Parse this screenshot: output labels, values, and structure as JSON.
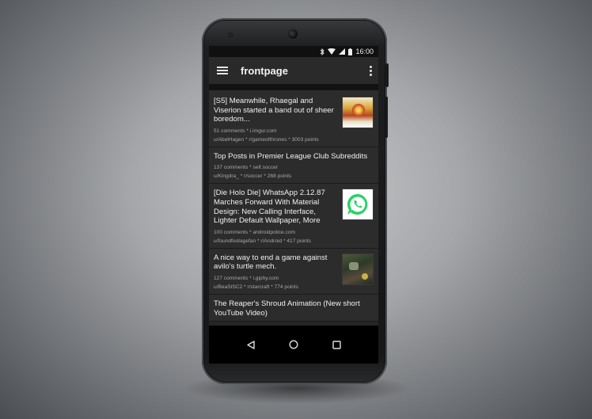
{
  "status_bar": {
    "time": "16:00",
    "icons": [
      "bluetooth-icon",
      "wifi-icon",
      "signal-icon",
      "battery-icon"
    ]
  },
  "app_bar": {
    "title": "frontpage",
    "menu_icon": "hamburger-menu-icon",
    "overflow_icon": "more-vert-icon"
  },
  "posts": [
    {
      "title": "[S5] Meanwhile, Rhaegal and Viserion started a band out of sheer boredom...",
      "comments_domain": "51 comments * i.imgur.com",
      "author_line": "u/AbelHagen * r/gameofthrones * 3003 points",
      "thumbnail": "dragon-band-thumbnail"
    },
    {
      "title": "Top Posts in Premier League Club Subreddits",
      "comments_domain": "137 comments * self.soccer",
      "author_line": "u/Kingdra_ * r/soccer * 268 points",
      "thumbnail": ""
    },
    {
      "title": "[Die Holo Die] WhatsApp 2.12.87 Marches Forward With Material Design: New Calling Interface, Lighter Default Wallpaper, More",
      "comments_domain": "100 comments * androidpolice.com",
      "author_line": "u/foundfootagefan * r/Android * 417 points",
      "thumbnail": "whatsapp-logo-thumbnail"
    },
    {
      "title": "A nice way to end a game against avilo's turtle mech.",
      "comments_domain": "127 comments * i.giphy.com",
      "author_line": "u/BeaStSC2 * r/starcraft * 774 points",
      "thumbnail": "starcraft-game-thumbnail"
    },
    {
      "title": "The Reaper's Shroud Animation (New short YouTube Video)",
      "comments_domain": "",
      "author_line": "",
      "thumbnail": ""
    }
  ],
  "nav_bar": {
    "buttons": [
      "back-icon",
      "home-icon",
      "recents-icon"
    ]
  },
  "colors": {
    "app_bar": "#2a2a2a",
    "card": "#2c2c2c",
    "title_text": "#f0f0f0",
    "meta_text": "#a7a7a7",
    "whatsapp_green": "#25d366"
  }
}
